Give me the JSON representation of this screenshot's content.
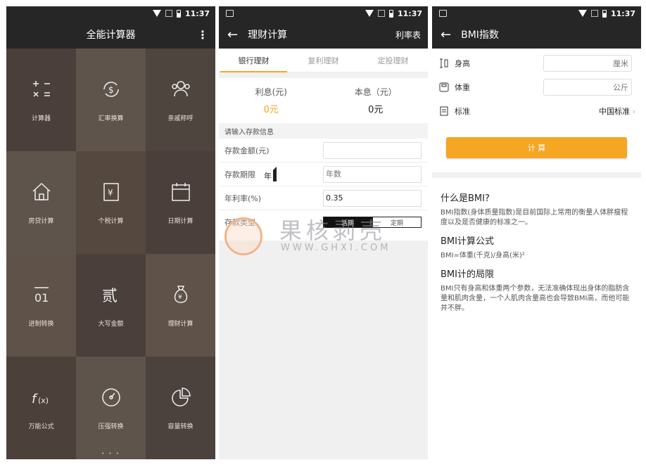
{
  "status_bar": {
    "time": "11:37"
  },
  "screen1": {
    "title": "全能计算器",
    "tiles": [
      {
        "label": "计算器",
        "icon": "calculator-icon",
        "bg": "#4a3f3a"
      },
      {
        "label": "汇率换算",
        "icon": "currency-exchange-icon",
        "bg": "#5f544c"
      },
      {
        "label": "亲戚称呼",
        "icon": "people-icon",
        "bg": "#4f453f"
      },
      {
        "label": "房贷计算",
        "icon": "house-icon",
        "bg": "#5f544b"
      },
      {
        "label": "个税计算",
        "icon": "tax-icon",
        "bg": "#55493f"
      },
      {
        "label": "日期计算",
        "icon": "calendar-icon",
        "bg": "#4a3f3a"
      },
      {
        "label": "进制转换",
        "icon": "base-convert-icon",
        "bg": "#5f5248"
      },
      {
        "label": "大写金额",
        "icon": "uppercase-amount-icon",
        "bg": "#4a3f3a"
      },
      {
        "label": "理财计算",
        "icon": "money-bag-icon",
        "bg": "#5e5249"
      },
      {
        "label": "万能公式",
        "icon": "formula-icon",
        "bg": "#4c403b"
      },
      {
        "label": "压强转换",
        "icon": "gauge-icon",
        "bg": "#5f544b"
      },
      {
        "label": "容量转换",
        "icon": "pie-icon",
        "bg": "#4c423d"
      }
    ],
    "pager": "• • •"
  },
  "screen2": {
    "title": "理财计算",
    "right_action": "利率表",
    "tabs": [
      "银行理财",
      "复利理财",
      "定投理财"
    ],
    "active_tab": 0,
    "interest_label": "利息(元)",
    "interest_value": "0元",
    "total_label": "本息（元）",
    "total_value": "0元",
    "section": "请输入存款信息",
    "amount_label": "存款金额(元)",
    "amount_value": "",
    "term_label": "存款期限",
    "term_unit": "年",
    "term_placeholder": "年数",
    "rate_label": "年利率(%)",
    "rate_value": "0.35",
    "type_label": "存款类型",
    "type_options": [
      "活期",
      "定期"
    ],
    "watermark": "果核剥壳",
    "watermark_url": "WWW.GHXI.COM"
  },
  "screen3": {
    "title": "BMI指数",
    "height_label": "身高",
    "height_unit": "厘米",
    "weight_label": "体重",
    "weight_unit": "公斤",
    "standard_label": "标准",
    "standard_value": "中国标准",
    "button": "计 算",
    "h1": "什么是BMI?",
    "p1": "BMI指数(身体质量指数)是目前国际上常用的衡量人体胖瘦程度以及是否健康的标准之一。",
    "h2": "BMI计算公式",
    "p2": "BMI=体重(千克)/身高(米)²",
    "h3": "BMI计的局限",
    "p3": "BMI只有身高和体重两个参数，无法准确体现出身体的脂肪含量和肌肉含量，一个人肌肉含量高也会导致BMI高，而他可能并不胖。"
  },
  "colors": {
    "accent": "#f5a623",
    "dark_bar": "#262626"
  }
}
